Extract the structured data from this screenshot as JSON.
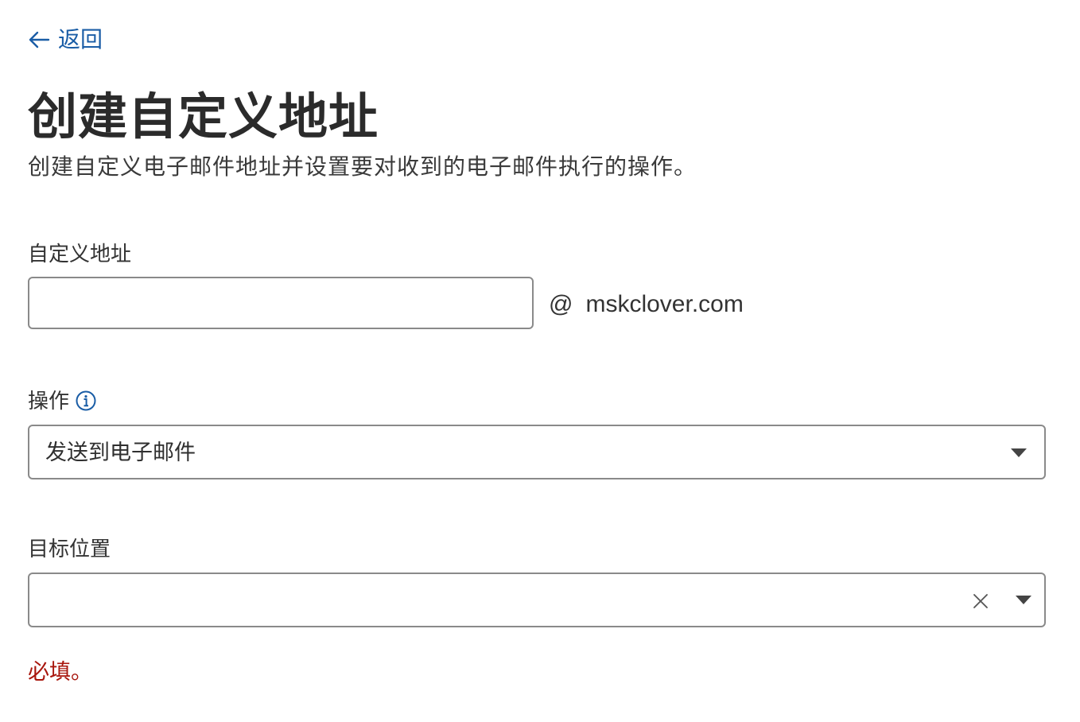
{
  "nav": {
    "back_label": "返回",
    "back_icon": "arrow-left-icon"
  },
  "header": {
    "title": "创建自定义地址",
    "subtitle": "创建自定义电子邮件地址并设置要对收到的电子邮件执行的操作。"
  },
  "form": {
    "custom_address": {
      "label": "自定义地址",
      "value": "",
      "placeholder": "",
      "at_symbol": "@",
      "domain": "mskclover.com"
    },
    "action": {
      "label": "操作",
      "info_icon": "info-icon",
      "selected": "发送到电子邮件"
    },
    "destination": {
      "label": "目标位置",
      "selected": "",
      "error": "必填。"
    }
  },
  "colors": {
    "link": "#1a5da6",
    "error": "#a8150c",
    "border": "#8a8a8a",
    "text": "#313131"
  }
}
